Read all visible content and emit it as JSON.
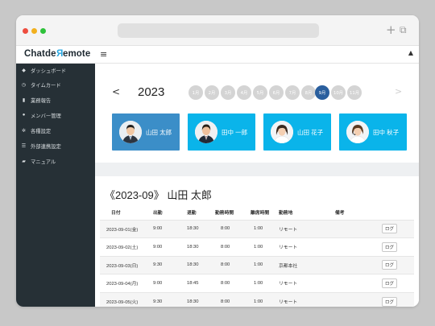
{
  "app": {
    "logo_prefix": "Chatde",
    "logo_accent": "R",
    "logo_suffix": "emote"
  },
  "window": {
    "toolbar_icons": [
      "+",
      "⧉"
    ]
  },
  "header": {
    "menu_icon": "≡",
    "user_icon": "▲"
  },
  "sidebar": {
    "items": [
      {
        "label": "ダッシュボード",
        "icon": "dashboard-icon",
        "glyph": "◆"
      },
      {
        "label": "タイムカード",
        "icon": "clock-icon",
        "glyph": "◷"
      },
      {
        "label": "業務報告",
        "icon": "report-icon",
        "glyph": "▮"
      },
      {
        "label": "メンバー管理",
        "icon": "member-icon",
        "glyph": "●"
      },
      {
        "label": "各種設定",
        "icon": "gear-icon",
        "glyph": "✲"
      },
      {
        "label": "外部連携設定",
        "icon": "list-icon",
        "glyph": "☰"
      },
      {
        "label": "マニュアル",
        "icon": "book-icon",
        "glyph": "▰"
      }
    ]
  },
  "calendar": {
    "prev_label": "<",
    "next_label": ">",
    "year": "2023",
    "months": [
      "1月",
      "2月",
      "3月",
      "4月",
      "5月",
      "6月",
      "7月",
      "8月",
      "9月",
      "10月",
      "11月"
    ],
    "active_month_index": 8
  },
  "members": [
    {
      "name": "山田 太郎",
      "selected": true
    },
    {
      "name": "田中 一郎",
      "selected": false
    },
    {
      "name": "山田 花子",
      "selected": false
    },
    {
      "name": "田中 秋子",
      "selected": false
    }
  ],
  "detail": {
    "title": "《2023-09》 山田 太郎",
    "columns": [
      "日付",
      "出勤",
      "退勤",
      "勤務時間",
      "離席時間",
      "勤務地",
      "備考",
      ""
    ],
    "rows": [
      {
        "date": "2023-09-01(金)",
        "start": "9:00",
        "end": "18:30",
        "work": "8:00",
        "away": "1:00",
        "location": "リモート",
        "note": "",
        "action": "ログ"
      },
      {
        "date": "2023-09-02(土)",
        "start": "9:00",
        "end": "18:30",
        "work": "8:00",
        "away": "1:00",
        "location": "リモート",
        "note": "",
        "action": "ログ"
      },
      {
        "date": "2023-09-03(日)",
        "start": "9:30",
        "end": "18:30",
        "work": "8:00",
        "away": "1:00",
        "location": "京都本社",
        "note": "",
        "action": "ログ"
      },
      {
        "date": "2023-09-04(月)",
        "start": "9:00",
        "end": "18:45",
        "work": "8:00",
        "away": "1:00",
        "location": "リモート",
        "note": "",
        "action": "ログ"
      },
      {
        "date": "2023-09-05(火)",
        "start": "9:30",
        "end": "18:30",
        "work": "8:00",
        "away": "1:00",
        "location": "リモート",
        "note": "",
        "action": "ログ"
      }
    ]
  },
  "colors": {
    "sidebar_bg": "#263036",
    "card_bg": "#0ab4ea",
    "card_selected_bg": "#3b8ec8",
    "active_month": "#2a5f9e",
    "logo_accent": "#2aa7e0"
  }
}
